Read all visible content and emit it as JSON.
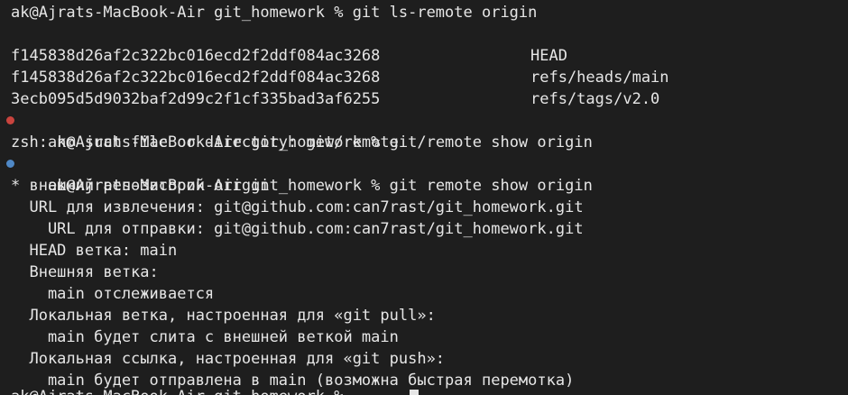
{
  "terminal": {
    "prompt_1": "ak@Ajrats-MacBook-Air git_homework % git ls-remote origin",
    "refs": [
      {
        "hash": "f145838d26af2c322bc016ecd2f2ddf084ac3268",
        "name": "HEAD"
      },
      {
        "hash": "f145838d26af2c322bc016ecd2f2ddf084ac3268",
        "name": "refs/heads/main"
      },
      {
        "hash": "3ecb095d5d9032baf2d99c2f1cf335bad3af6255",
        "name": "refs/tags/v2.0"
      }
    ],
    "prompt_2": "ak@Ajrats-MacBook-Air git_homework % git/remote show origin",
    "error_line": "zsh: no such file or directory: git/remote",
    "prompt_3": "ak@Ajrats-MacBook-Air git_homework % git remote show origin",
    "output": [
      "* внешний репозиторий origin",
      "  URL для извлечения: git@github.com:can7rast/git_homework.git",
      "    URL для отправки: git@github.com:can7rast/git_homework.git",
      "  HEAD ветка: main",
      "  Внешняя ветка:",
      "    main отслеживается",
      "  Локальная ветка, настроенная для «git pull»:",
      "    main будет слита с внешней веткой main",
      "  Локальная ссылка, настроенная для «git push»:",
      "    main будет отправлена в main (возможна быстрая перемотка)"
    ],
    "prompt_4_partial": "ak@Ajrats-MacBook-Air git_homework % "
  },
  "colors": {
    "background": "#1e1e1e",
    "text": "#e6e6e6",
    "error_marker": "#c9443e",
    "success_marker": "#4f88c6"
  }
}
